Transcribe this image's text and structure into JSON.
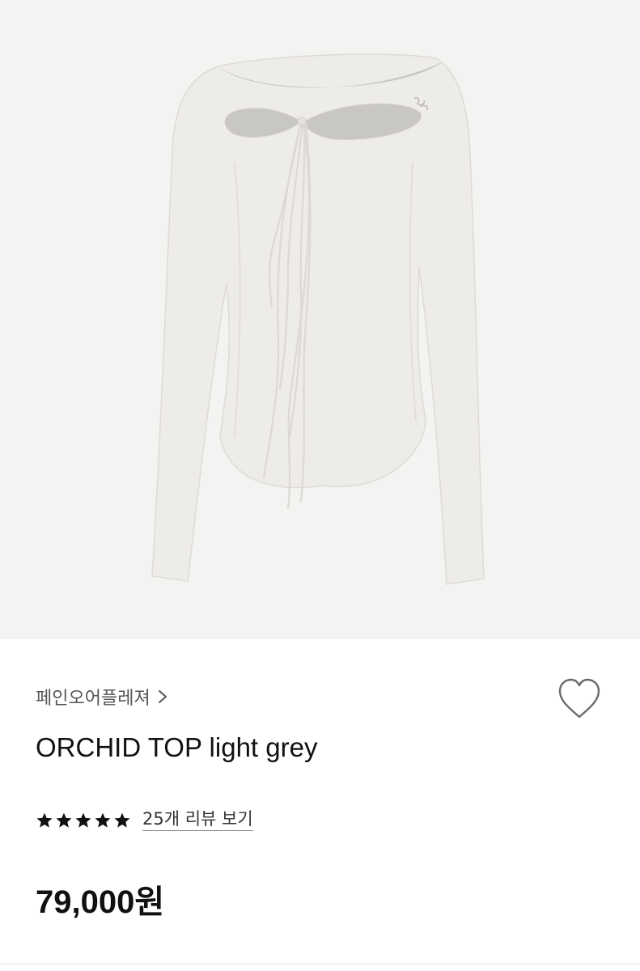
{
  "product": {
    "brand": "페인오어플레져",
    "brand_chevron_icon": "chevron-right-icon",
    "title": "ORCHID TOP light grey",
    "rating": 5,
    "rating_max": 5,
    "review_link": "25개 리뷰 보기",
    "price": "79,000원",
    "wishlist_icon": "heart-outline-icon",
    "image_subject": "light grey long-sleeve top with cutout and tie strings"
  },
  "colors": {
    "hero_bg": "#f3f3f2",
    "garment": "#efede9",
    "text_primary": "#111111",
    "text_secondary": "#555555",
    "star": "#111111"
  }
}
